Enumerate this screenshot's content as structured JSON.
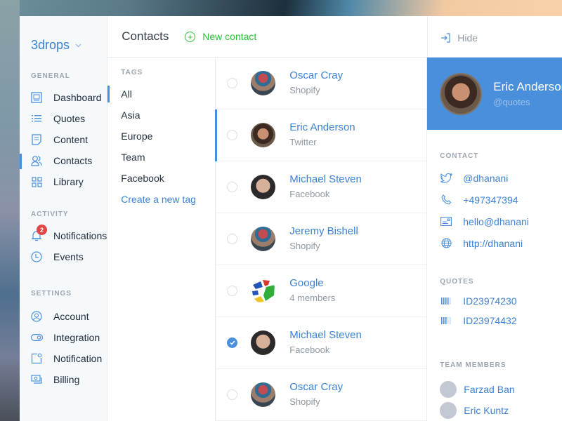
{
  "sidebar": {
    "brand": "3drops",
    "sections": [
      {
        "title": "GENERAL",
        "items": [
          {
            "label": "Dashboard",
            "icon": "dashboard-icon"
          },
          {
            "label": "Quotes",
            "icon": "list-icon"
          },
          {
            "label": "Content",
            "icon": "document-icon"
          },
          {
            "label": "Contacts",
            "icon": "contacts-icon",
            "active": true
          },
          {
            "label": "Library",
            "icon": "grid-icon"
          }
        ]
      },
      {
        "title": "ACTIVITY",
        "items": [
          {
            "label": "Notifications",
            "icon": "bell-icon",
            "badge": "2"
          },
          {
            "label": "Events",
            "icon": "clock-icon"
          }
        ]
      },
      {
        "title": "SETTINGS",
        "items": [
          {
            "label": "Account",
            "icon": "user-circle-icon"
          },
          {
            "label": "Integration",
            "icon": "toggle-icon"
          },
          {
            "label": "Notification",
            "icon": "notification-square-icon"
          },
          {
            "label": "Billing",
            "icon": "billing-icon"
          }
        ]
      }
    ]
  },
  "header": {
    "title": "Contacts",
    "new_contact_label": "New contact",
    "hide_label": "Hide"
  },
  "tags": {
    "title": "TAGS",
    "items": [
      "All",
      "Asia",
      "Europe",
      "Team",
      "Facebook"
    ],
    "active": "All",
    "create_label": "Create a new tag"
  },
  "contacts": [
    {
      "name": "Oscar Cray",
      "sub": "Shopify",
      "avatar": "oscar",
      "checked": false,
      "active": false
    },
    {
      "name": "Eric Anderson",
      "sub": "Twitter",
      "avatar": "eric",
      "checked": false,
      "active": true
    },
    {
      "name": "Michael Steven",
      "sub": "Facebook",
      "avatar": "michael",
      "checked": false,
      "active": false
    },
    {
      "name": "Jeremy Bishell",
      "sub": "Shopify",
      "avatar": "oscar",
      "checked": false,
      "active": false
    },
    {
      "name": "Google",
      "sub": "4 members",
      "avatar": "google",
      "checked": false,
      "active": false
    },
    {
      "name": "Michael Steven",
      "sub": "Facebook",
      "avatar": "michael",
      "checked": true,
      "active": false
    },
    {
      "name": "Oscar Cray",
      "sub": "Shopify",
      "avatar": "oscar",
      "checked": false,
      "active": false
    }
  ],
  "detail": {
    "name": "Eric Anderson",
    "handle": "@quotes",
    "contact_title": "CONTACT",
    "contact": {
      "twitter": "@dhanani",
      "phone": "+497347394",
      "email": "hello@dhanani",
      "website": "http://dhanani"
    },
    "quotes_title": "QUOTES",
    "quotes": [
      "ID23974230",
      "ID23974432"
    ],
    "team_title": "TEAM MEMBERS",
    "team": [
      "Farzad Ban",
      "Eric Kuntz"
    ]
  },
  "colors": {
    "accent": "#4a8fdc",
    "link": "#3b82d6",
    "success": "#2bbf3a",
    "badge": "#e04646"
  }
}
